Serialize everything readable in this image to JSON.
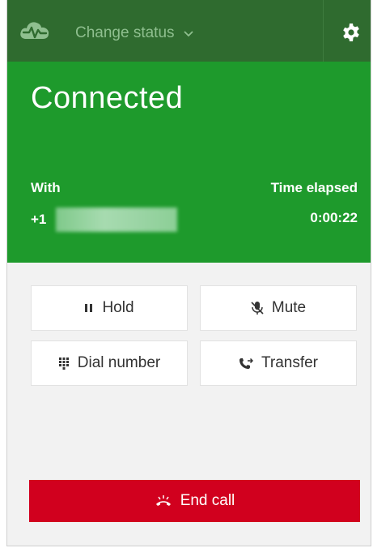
{
  "header": {
    "status_label": "Change status",
    "colors": {
      "bar": "#2f6b2f",
      "status_text": "#8fbf8f"
    }
  },
  "call": {
    "state": "Connected",
    "with_label": "With",
    "with_number_prefix": "+1",
    "time_label": "Time elapsed",
    "time_value": "0:00:22",
    "colors": {
      "panel": "#1e9a2c"
    }
  },
  "actions": {
    "hold": "Hold",
    "mute": "Mute",
    "dial": "Dial number",
    "transfer": "Transfer"
  },
  "end_call": {
    "label": "End call",
    "color": "#d1001e"
  },
  "icons": [
    "cloud-logo-icon",
    "chevron-down-icon",
    "gear-icon",
    "pause-icon",
    "mic-off-icon",
    "dialpad-icon",
    "transfer-icon",
    "hangup-icon"
  ]
}
